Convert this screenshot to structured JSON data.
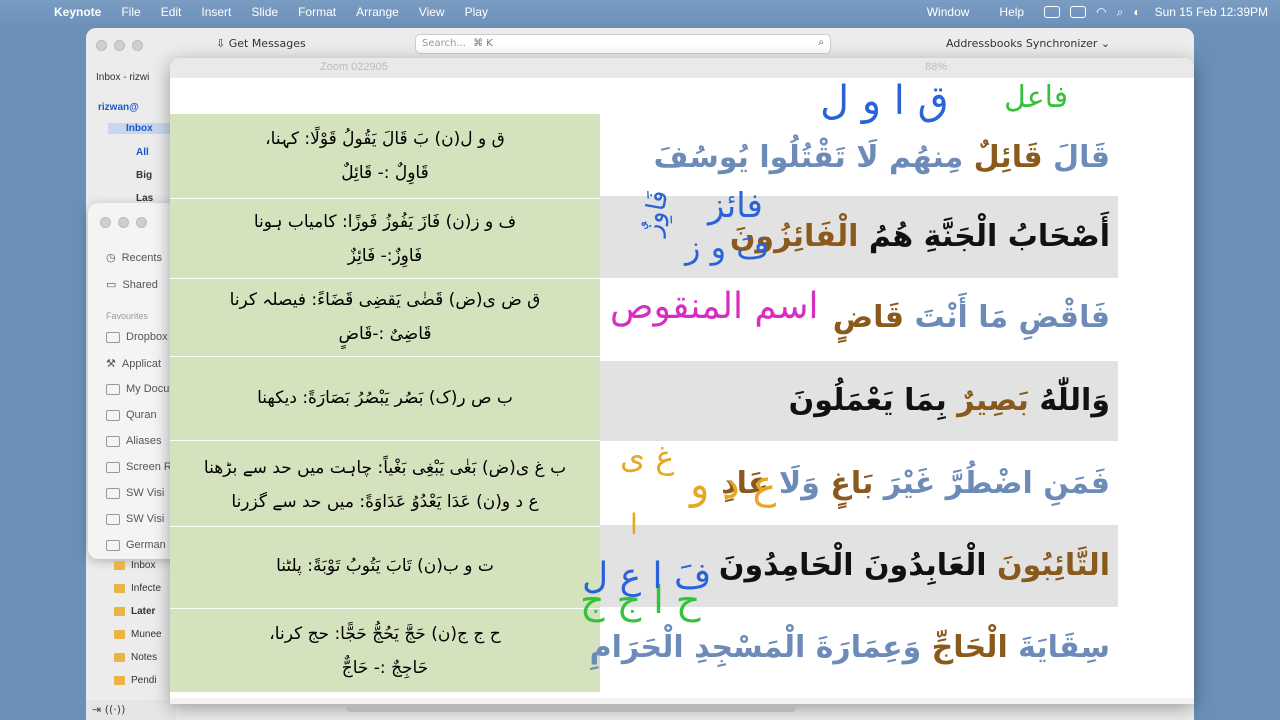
{
  "menubar": {
    "app": "Keynote",
    "items": [
      "File",
      "Edit",
      "Insert",
      "Slide",
      "Format",
      "Arrange",
      "View",
      "Play"
    ],
    "right_items": [
      "Window",
      "Help"
    ],
    "clock": "Sun 15 Feb  12:39PM"
  },
  "mail": {
    "get_messages": "Get Messages",
    "search_placeholder": "Search...",
    "search_shortcut": "⌘ K",
    "addon": "Addressbooks Synchronizer",
    "inbox_header": "Inbox - rizwi",
    "account": "rizwan@",
    "inbox": "Inbox",
    "folders": [
      "All",
      "Big",
      "Las"
    ]
  },
  "finder": {
    "items": [
      "Recents",
      "Shared"
    ],
    "favourites_label": "Favourites",
    "favourites": [
      "Dropbox",
      "Applicat",
      "My Docu",
      "Quran",
      "Aliases",
      "Screen R",
      "SW Visi",
      "SW Visi",
      "German"
    ]
  },
  "folder_list": [
    "Inbox",
    "Infecte",
    "Later",
    "Munee",
    "Notes",
    "Pendi"
  ],
  "zoom_title": "Zoom 022905",
  "zoom_level": "88%",
  "slide": {
    "left_rows": [
      {
        "line1": "ق و ل(ن) بَ قَالَ یَقُولُ قَوْلًا: کہنا،",
        "line2": "قَاوِلٌ :- قَائِلٌ"
      },
      {
        "line1": "ف و ز(ن) فَازَ یَفُوزُ فَوزًا: کامیاب ہونا",
        "line2": "فَاوِزٌ:- فَائِزٌ"
      },
      {
        "line1": "ق ض ی(ض) قَضٰی یَقضِی قَضَاءً: فیصلہ کرنا",
        "line2": "قَاضِیٌ :-قَاضٍ"
      },
      {
        "line1": "ب ص ر(ک) بَصُر یَبْصُرُ بَصَارَةً: دیکھنا",
        "line2": ""
      },
      {
        "line1": "ب غ ی(ض) بَغٰی یَبْغِی بَغْیاً: چاہت میں حد سے بڑھنا",
        "line2": "ع د و(ن) عَدَا یَعْدُوُ عَدَاوَةً: میں حد سے گزرنا"
      },
      {
        "line1": "ت و ب(ن) تَابَ یَتُوبُ تَوْبَةً: پلٹنا",
        "line2": ""
      },
      {
        "line1": "ح ج ج(ن) حَجَّ یَحُجُّ حَجًّا: حج کرنا،",
        "line2": "حَاجِجٌ :- حَاجٌّ"
      }
    ],
    "right_rows": [
      {
        "parts": [
          {
            "t": "قَالَ ",
            "c": "c-blue"
          },
          {
            "t": "قَائِلٌ ",
            "c": "c-brown"
          },
          {
            "t": "مِنهُم لَا تَقْتُلُوا یُوسُفَ",
            "c": "c-blue"
          }
        ]
      },
      {
        "parts": [
          {
            "t": "أَصْحَابُ الْجَنَّةِ هُمُ ",
            "c": "c-black"
          },
          {
            "t": "الْفَائِزُونَ",
            "c": "c-brown"
          }
        ]
      },
      {
        "parts": [
          {
            "t": "فَاقْضِ مَا أَنْتَ ",
            "c": "c-blue"
          },
          {
            "t": "قَاضٍ",
            "c": "c-brown"
          }
        ]
      },
      {
        "parts": [
          {
            "t": "وَاللّٰهُ ",
            "c": "c-black"
          },
          {
            "t": "بَصِیرٌ ",
            "c": "c-brown"
          },
          {
            "t": "بِمَا یَعْمَلُونَ",
            "c": "c-black"
          }
        ]
      },
      {
        "parts": [
          {
            "t": "فَمَنِ اضْطُرَّ غَیْرَ ",
            "c": "c-blue"
          },
          {
            "t": "بَاغٍ ",
            "c": "c-brown"
          },
          {
            "t": "وَلَا ",
            "c": "c-blue"
          },
          {
            "t": "عَادٍ",
            "c": "c-brown"
          }
        ]
      },
      {
        "parts": [
          {
            "t": "التَّائِبُونَ ",
            "c": "c-brown"
          },
          {
            "t": "الْعَابِدُونَ الْحَامِدُونَ",
            "c": "c-black"
          }
        ]
      },
      {
        "parts": [
          {
            "t": "سِقَایَةَ ",
            "c": "c-blue"
          },
          {
            "t": "الْحَاجِّ ",
            "c": "c-brown"
          },
          {
            "t": "وَعِمَارَةَ الْمَسْجِدِ الْحَرَامِ",
            "c": "c-blue"
          }
        ]
      }
    ],
    "annotations": {
      "qwl": "ق ا و ل",
      "faail": "فاعل",
      "faawiz": "فَاوِزٌ",
      "fawaz": "فَ و ز",
      "faaiz": "فائز",
      "ism": "اسم المنقوص",
      "ayn": "ع د و",
      "ghay": "غ ی",
      "alif": "ا",
      "haajj": "ح ا ج ج",
      "fa_ayn": "فَ ا ع ل"
    }
  },
  "colors": {
    "left_bg": "#d4e2bd",
    "grey_row": "#e2e2e2",
    "blue_text": "#6d8bb8",
    "brown_text": "#8a5a1c",
    "ink_blue": "#2a63d8",
    "ink_green": "#33c23a",
    "ink_magenta": "#d62fc0",
    "ink_orange": "#e8a623"
  }
}
